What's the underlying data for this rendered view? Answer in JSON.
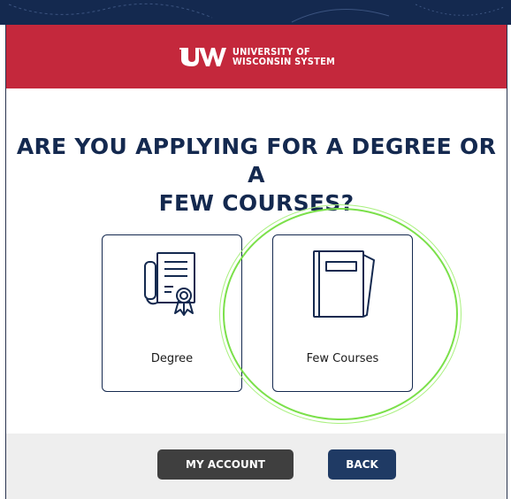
{
  "header": {
    "logo_line1": "UNIVERSITY OF",
    "logo_line2": "WISCONSIN SYSTEM",
    "brand_color": "#c4283c"
  },
  "main": {
    "title_line1": "ARE YOU APPLYING FOR A DEGREE OR A",
    "title_line2": "FEW COURSES?",
    "options": [
      {
        "label": "Degree",
        "icon": "diploma-icon"
      },
      {
        "label": "Few Courses",
        "icon": "book-icon"
      }
    ]
  },
  "footer": {
    "my_account_label": "MY ACCOUNT",
    "back_label": "BACK"
  },
  "colors": {
    "navy": "#14294f",
    "highlight": "#7be04a",
    "account_button": "#3f3f3f",
    "back_button": "#1f3a64"
  }
}
